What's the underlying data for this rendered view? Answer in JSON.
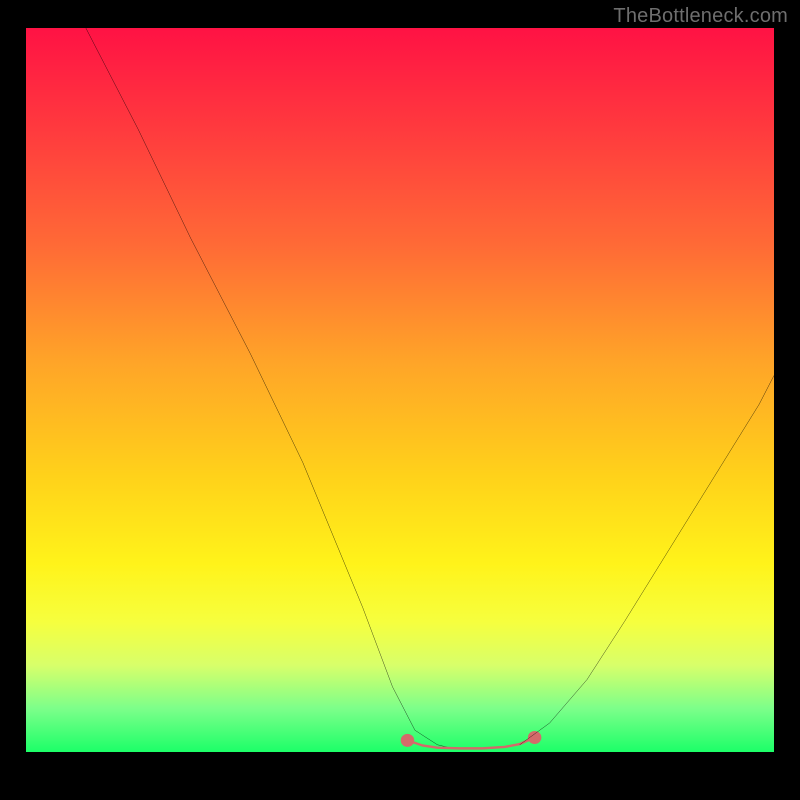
{
  "watermark": "TheBottleneck.com",
  "chart_data": {
    "type": "line",
    "title": "",
    "xlabel": "",
    "ylabel": "",
    "xlim": [
      0,
      100
    ],
    "ylim": [
      0,
      100
    ],
    "grid": false,
    "legend": false,
    "note": "Axes unlabeled; values estimated from pixel positions. Lower y is better (green). Two curves descend to a flat minimum then one rises.",
    "series": [
      {
        "name": "left-curve",
        "color": "#000000",
        "x": [
          8,
          15,
          22,
          30,
          37,
          45,
          49,
          52,
          55,
          57
        ],
        "y": [
          100,
          86,
          71,
          55,
          40,
          20,
          9,
          3,
          1,
          0.5
        ]
      },
      {
        "name": "valley-floor",
        "color": "#d46a6a",
        "thick": true,
        "x": [
          51,
          53,
          55,
          58,
          61,
          64,
          66,
          68
        ],
        "y": [
          1.6,
          0.9,
          0.6,
          0.5,
          0.5,
          0.7,
          1.1,
          2.0
        ]
      },
      {
        "name": "right-curve",
        "color": "#000000",
        "x": [
          66,
          70,
          75,
          80,
          86,
          92,
          98,
          100
        ],
        "y": [
          1,
          4,
          10,
          18,
          28,
          38,
          48,
          52
        ]
      }
    ]
  }
}
